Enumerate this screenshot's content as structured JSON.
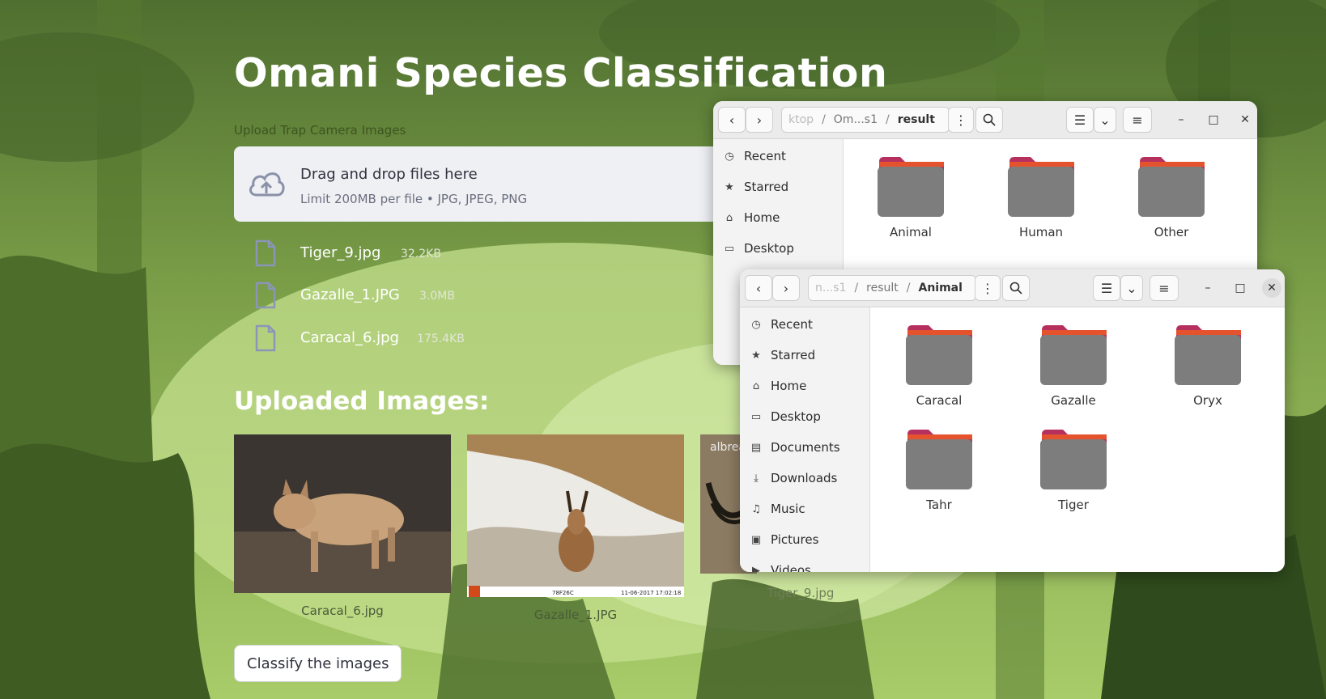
{
  "app": {
    "title": "Omani Species Classification",
    "upload_label": "Upload Trap Camera Images",
    "dropzone": {
      "title": "Drag and drop files here",
      "subtitle": "Limit 200MB per file • JPG, JPEG, PNG"
    },
    "files": [
      {
        "name": "Tiger_9.jpg",
        "size": "32.2KB"
      },
      {
        "name": "Gazalle_1.JPG",
        "size": "3.0MB"
      },
      {
        "name": "Caracal_6.jpg",
        "size": "175.4KB"
      }
    ],
    "uploaded_title": "Uploaded Images:",
    "images": [
      {
        "caption": "Caracal_6.jpg"
      },
      {
        "caption": "Gazalle_1.JPG",
        "stamp_left": "78F26C",
        "stamp_right": "11-06-2017 17:02:18"
      },
      {
        "caption": "Tiger_9.jpg",
        "watermark": "albrea"
      }
    ],
    "classify_button": "Classify the images"
  },
  "fm_back": {
    "path": [
      "ktop",
      "Om...s1",
      "result"
    ],
    "sidebar": [
      "Recent",
      "Starred",
      "Home",
      "Desktop"
    ],
    "folders": [
      "Animal",
      "Human",
      "Other"
    ]
  },
  "fm_front": {
    "path": [
      "n...s1",
      "result",
      "Animal"
    ],
    "sidebar": [
      "Recent",
      "Starred",
      "Home",
      "Desktop",
      "Documents",
      "Downloads",
      "Music",
      "Pictures",
      "Videos"
    ],
    "folders": [
      "Caracal",
      "Gazalle",
      "Oryx",
      "Tahr",
      "Tiger"
    ]
  },
  "colors": {
    "folder_top": "#b5305f",
    "folder_accent": "#e5532e",
    "folder_body": "#7d7d7d",
    "jungle_dark": "#3e5a24",
    "jungle_light": "#c9e39a"
  }
}
